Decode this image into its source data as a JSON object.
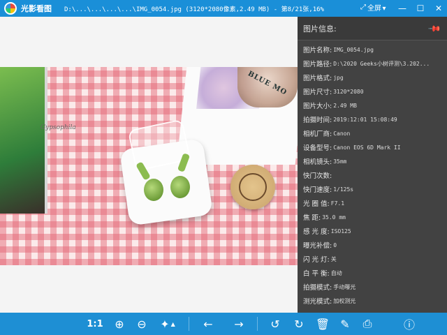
{
  "titlebar": {
    "app_name": "光影看图",
    "file_title": "D:\\...\\...\\...\\...\\IMG_0054.jpg (3120*2080像素,2.49 MB) - 第8/21张,16%",
    "fullscreen_label": "全屏",
    "fullscreen_icon": "expand-icon",
    "buttons": [
      "pin-top-icon",
      "minimize-icon",
      "maximize-icon",
      "close-icon"
    ]
  },
  "photo": {
    "card_text": "Gypsophila",
    "jar_text": "BLUE MO"
  },
  "info_panel": {
    "title": "图片信息:",
    "pin_icon": "pin-icon",
    "rows": [
      {
        "label": "图片名称:",
        "value": "IMG_0054.jpg"
      },
      {
        "label": "图片路径:",
        "value": "D:\\2020 Geeks小树评测\\3.202..."
      },
      {
        "label": "图片格式:",
        "value": "jpg"
      },
      {
        "label": "图片尺寸:",
        "value": "3120*2080"
      },
      {
        "label": "图片大小:",
        "value": "2.49 MB"
      },
      {
        "label": "拍摄时间:",
        "value": "2019:12:01 15:08:49"
      },
      {
        "label": "相机厂商:",
        "value": "Canon"
      },
      {
        "label": "设备型号:",
        "value": "Canon EOS 6D Mark II"
      },
      {
        "label": "相机镜头:",
        "value": "35mm"
      },
      {
        "label": "快门次数:",
        "value": ""
      },
      {
        "label": "快门速度:",
        "value": "1/125s"
      },
      {
        "label": "光 圈 值:",
        "value": "F7.1"
      },
      {
        "label": "焦    距:",
        "value": "35.0 mm"
      },
      {
        "label": "感 光 度:",
        "value": "ISO125"
      },
      {
        "label": "曝光补偿:",
        "value": "0"
      },
      {
        "label": "闪 光 灯:",
        "value": "关"
      },
      {
        "label": "白 平 衡:",
        "value": "自动"
      },
      {
        "label": "拍摄模式:",
        "value": "手动曝光"
      },
      {
        "label": "测光模式:",
        "value": "加权测光"
      }
    ]
  },
  "toolbar": {
    "actual_size_label": "1:1",
    "items": [
      {
        "name": "zoom-in-icon",
        "glyph": "⊕"
      },
      {
        "name": "zoom-out-icon",
        "glyph": "⊖"
      },
      {
        "name": "magic-wand-icon",
        "glyph": "✦"
      },
      {
        "name": "previous-arrow-icon",
        "glyph": "←"
      },
      {
        "name": "next-arrow-icon",
        "glyph": "→"
      },
      {
        "name": "rotate-left-icon",
        "glyph": "↺"
      },
      {
        "name": "rotate-right-icon",
        "glyph": "↻"
      },
      {
        "name": "delete-icon",
        "glyph": "🗑"
      },
      {
        "name": "edit-icon",
        "glyph": "✎"
      },
      {
        "name": "print-icon",
        "glyph": "⎙"
      },
      {
        "name": "info-icon",
        "glyph": "ⓘ"
      }
    ],
    "wand_dropdown_glyph": "▲",
    "colors": {
      "accent": "#1e8fd4",
      "panel": "#424242"
    }
  }
}
